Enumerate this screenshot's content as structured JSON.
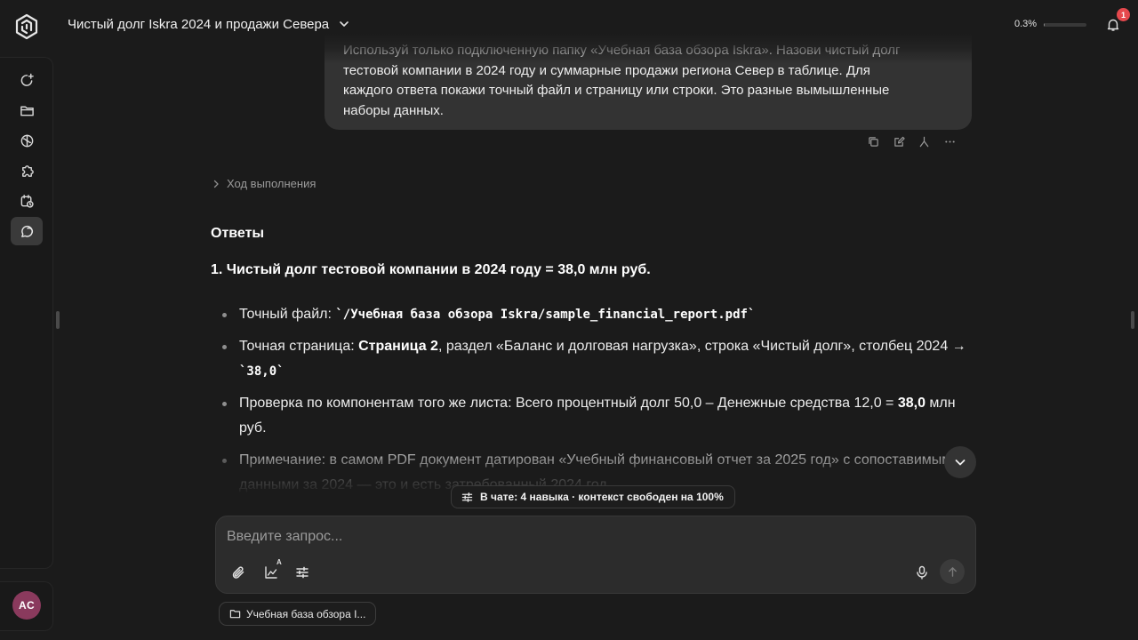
{
  "header": {
    "chat_title": "Чистый долг Iskra 2024 и продажи Севера",
    "usage_percent": "0.3%",
    "usage_fraction": 0.003,
    "notifications_count": "1"
  },
  "sidebar": {
    "items": [
      {
        "icon": "new-chat-icon",
        "active": false
      },
      {
        "icon": "folder-icon",
        "active": false
      },
      {
        "icon": "brain-icon",
        "active": false
      },
      {
        "icon": "puzzle-icon",
        "active": false
      },
      {
        "icon": "schedule-icon",
        "active": false
      },
      {
        "icon": "chats-icon",
        "active": true
      }
    ],
    "avatar_initials": "AC"
  },
  "user_message": {
    "line1": "Используй только подключенную папку «Учебная база обзора Iskra». Назови чистый долг",
    "line2": "тестовой компании в 2024 году и суммарные продажи региона Север в таблице. Для",
    "line3": "каждого ответа покажи точный файл и страницу или строки. Это разные вымышленные",
    "line4": "наборы данных."
  },
  "progress": {
    "label": "Ход выполнения"
  },
  "answer": {
    "heading": "Ответы",
    "item1_heading": "1. Чистый долг тестовой компании в 2024 году = 38,0 млн руб.",
    "bullets": [
      {
        "label": "Точный файл: ",
        "code": "`/Учебная база обзора Iskra/sample_financial_report.pdf`"
      },
      {
        "label": "Точная страница: ",
        "bold": "Страница 2",
        "rest": ", раздел «Баланс и долговая нагрузка», строка «Чистый долг», столбец 2024 → ",
        "code": "`38,0`"
      },
      {
        "label": "Проверка по компонентам того же листа: Всего процентный долг 50,0 – Денежные средства 12,0 = ",
        "bold": "38,0",
        "rest": " млн руб."
      },
      {
        "label": "Примечание: в самом PDF документ датирован «Учебный финансовый отчет за 2025 год» с сопоставимыми данными за 2024 — это и есть затребованный 2024 год."
      }
    ]
  },
  "context_pill": {
    "label": "В чате: 4 навыка · контекст свободен на 100%"
  },
  "composer": {
    "placeholder": "Введите запрос..."
  },
  "folder_chip": {
    "label": "Учебная база обзора I..."
  },
  "colors": {
    "background": "#1b1b1b",
    "bubble": "#333333",
    "badge": "#e5484d",
    "avatar": "#8a3a5d"
  }
}
